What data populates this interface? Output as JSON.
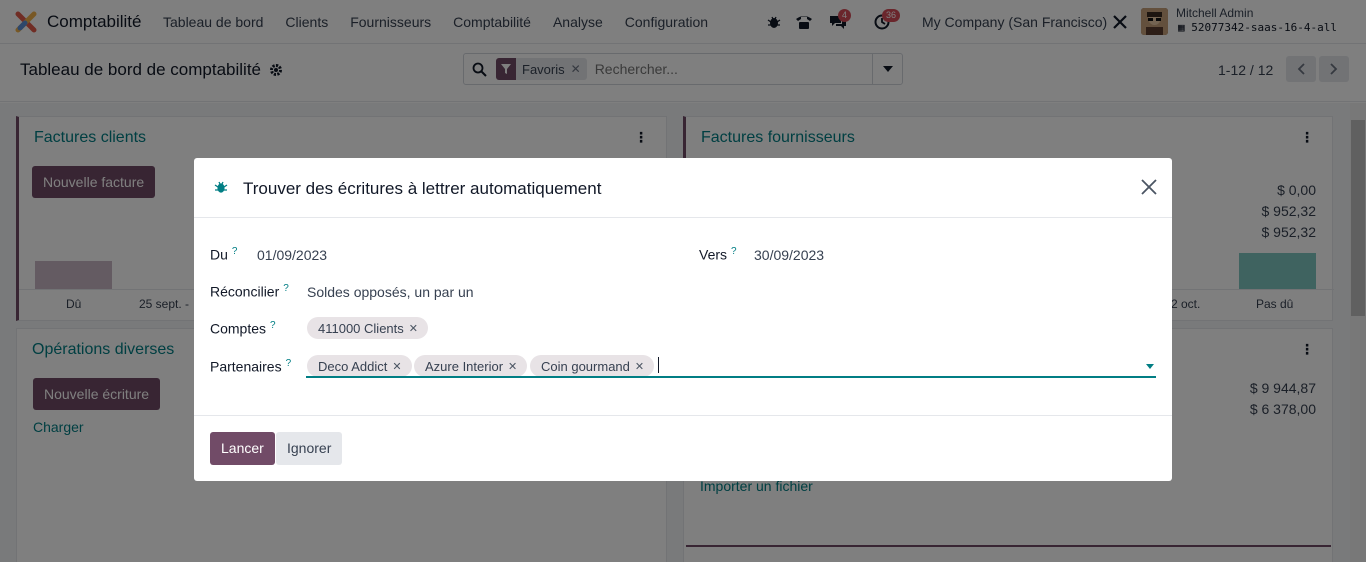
{
  "navbar": {
    "app_title": "Comptabilité",
    "menu": [
      "Tableau de bord",
      "Clients",
      "Fournisseurs",
      "Comptabilité",
      "Analyse",
      "Configuration"
    ],
    "messages_count": "4",
    "activities_count": "36",
    "company": "My Company (San Francisco)",
    "user_name": "Mitchell Admin",
    "database": "52077342-saas-16-4-all"
  },
  "control": {
    "breadcrumb": "Tableau de bord de comptabilité",
    "search_facet": "Favoris",
    "search_placeholder": "Rechercher...",
    "pager": "1-12 / 12"
  },
  "dashboard": {
    "customer_invoices": {
      "title": "Factures clients",
      "button": "Nouvelle facture",
      "graph_labels": [
        "Dû",
        "25 sept. -"
      ]
    },
    "vendor_bills": {
      "title": "Factures fournisseurs",
      "amounts": [
        "$ 0,00",
        "$ 952,32",
        "$ 952,32"
      ],
      "graph_labels": [
        "2 oct.",
        "Pas dû"
      ],
      "upload_link": "Importer un fichier"
    },
    "misc_operations": {
      "title": "Opérations diverses",
      "button": "Nouvelle écriture",
      "link": "Charger"
    },
    "bank": {
      "amounts": [
        "$ 9 944,87",
        "$ 6 378,00"
      ]
    }
  },
  "modal": {
    "title": "Trouver des écritures à lettrer automatiquement",
    "from_label": "Du",
    "from_value": "01/09/2023",
    "to_label": "Vers",
    "to_value": "30/09/2023",
    "reconcile_label": "Réconcilier",
    "reconcile_value": "Soldes opposés, un par un",
    "accounts_label": "Comptes",
    "accounts": [
      "411000 Clients"
    ],
    "partners_label": "Partenaires",
    "partners": [
      "Deco Addict",
      "Azure Interior",
      "Coin gourmand"
    ],
    "help_mark": "?",
    "launch_button": "Lancer",
    "discard_button": "Ignorer"
  },
  "colors": {
    "brand": "#714b67",
    "accent": "#017e84",
    "badge": "#d44c59"
  }
}
